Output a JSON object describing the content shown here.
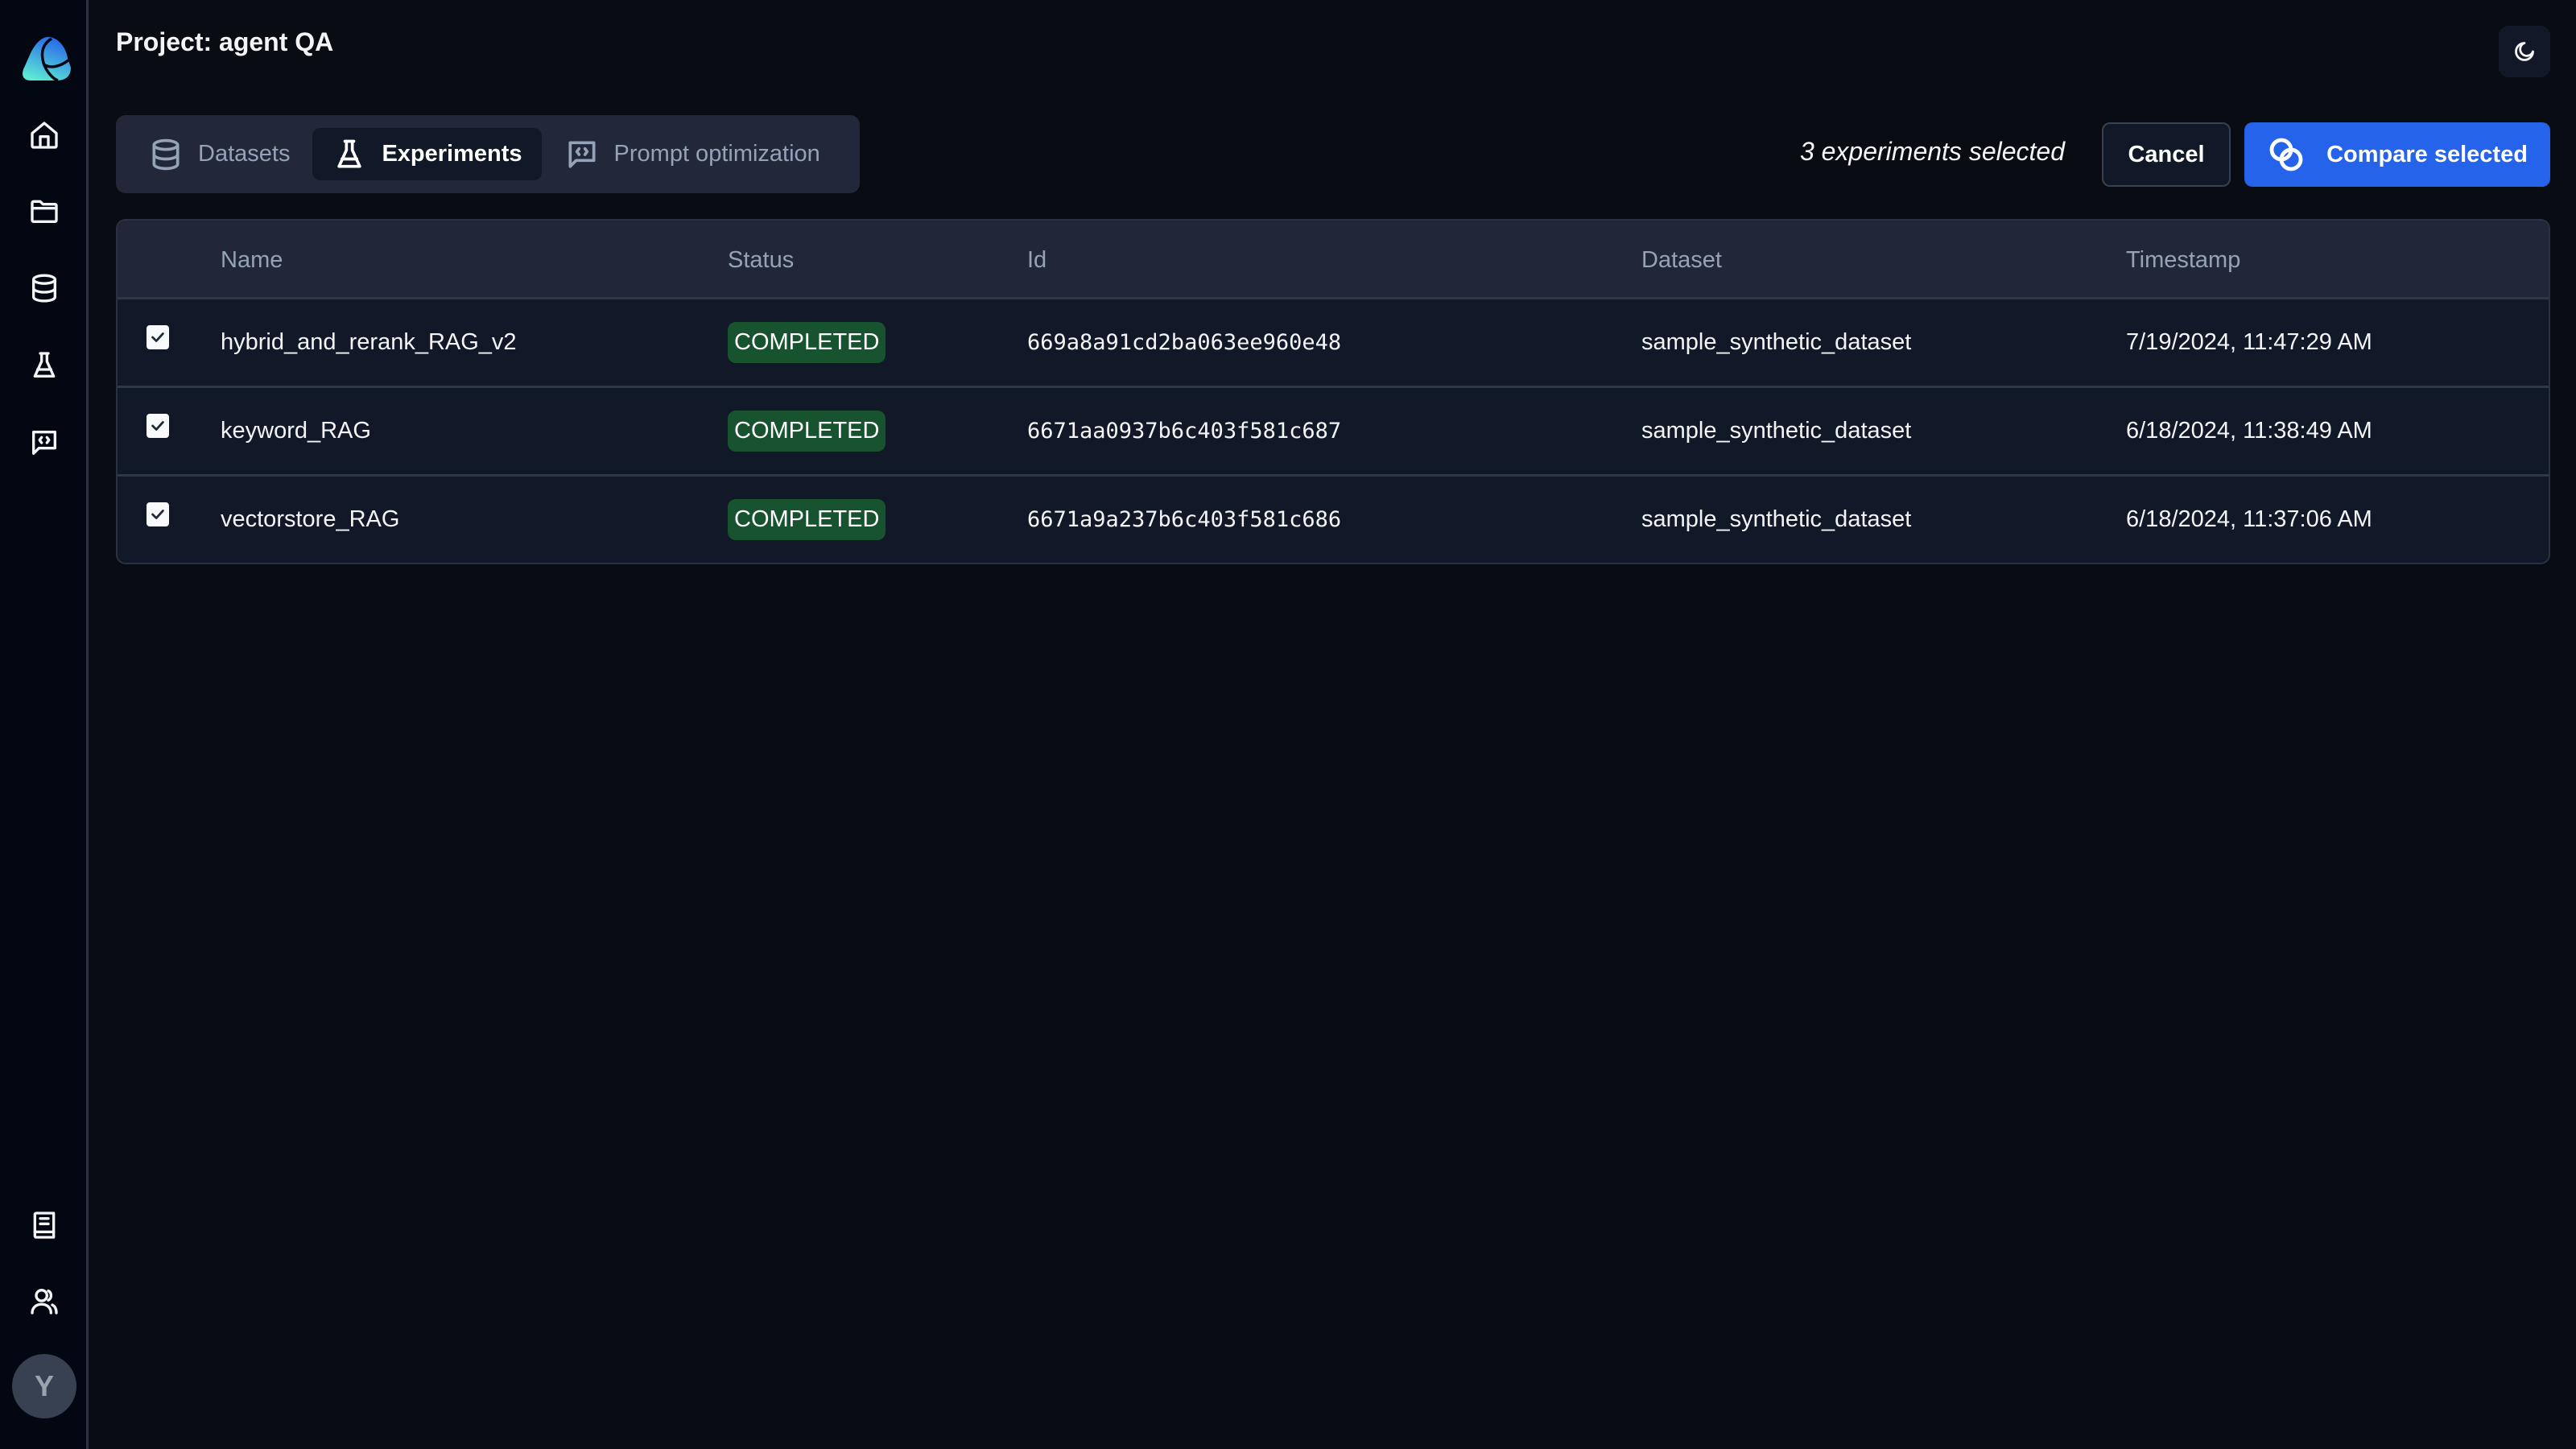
{
  "header": {
    "title": "Project: agent QA",
    "theme_toggle_icon": "moon-icon"
  },
  "sidebar": {
    "logo": "app-logo",
    "top_items": [
      {
        "icon": "home-icon"
      },
      {
        "icon": "folder-icon"
      },
      {
        "icon": "database-icon"
      },
      {
        "icon": "flask-icon"
      },
      {
        "icon": "message-code-icon"
      }
    ],
    "bottom_items": [
      {
        "icon": "book-icon"
      },
      {
        "icon": "users-icon"
      }
    ],
    "avatar_initial": "Y"
  },
  "tabs": [
    {
      "label": "Datasets",
      "icon": "database-icon",
      "active": false
    },
    {
      "label": "Experiments",
      "icon": "flask-icon",
      "active": true
    },
    {
      "label": "Prompt optimization",
      "icon": "message-code-icon",
      "active": false
    }
  ],
  "selection": {
    "count_text": "3 experiments selected",
    "cancel_label": "Cancel",
    "compare_label": "Compare selected"
  },
  "table": {
    "columns": [
      "Name",
      "Status",
      "Id",
      "Dataset",
      "Timestamp"
    ],
    "rows": [
      {
        "checked": true,
        "name": "hybrid_and_rerank_RAG_v2",
        "status": "COMPLETED",
        "id": "669a8a91cd2ba063ee960e48",
        "dataset": "sample_synthetic_dataset",
        "timestamp": "7/19/2024, 11:47:29 AM"
      },
      {
        "checked": true,
        "name": "keyword_RAG",
        "status": "COMPLETED",
        "id": "6671aa0937b6c403f581c687",
        "dataset": "sample_synthetic_dataset",
        "timestamp": "6/18/2024, 11:38:49 AM"
      },
      {
        "checked": true,
        "name": "vectorstore_RAG",
        "status": "COMPLETED",
        "id": "6671a9a237b6c403f581c686",
        "dataset": "sample_synthetic_dataset",
        "timestamp": "6/18/2024, 11:37:06 AM"
      }
    ]
  },
  "colors": {
    "accent": "#2563eb",
    "status_completed_bg": "#17532f"
  }
}
